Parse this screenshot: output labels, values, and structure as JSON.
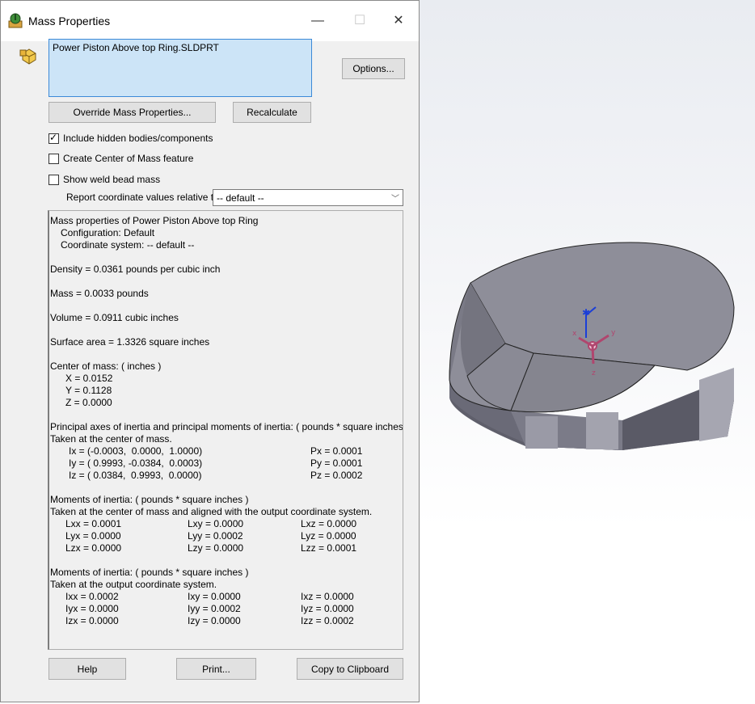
{
  "window": {
    "title": "Mass Properties",
    "minimize": "—",
    "maximize": "☐",
    "close": "✕"
  },
  "part_list": {
    "item": "Power Piston Above top Ring.SLDPRT"
  },
  "buttons": {
    "options": "Options...",
    "override": "Override Mass Properties...",
    "recalculate": "Recalculate",
    "help": "Help",
    "print": "Print...",
    "copy": "Copy to Clipboard"
  },
  "checkboxes": {
    "include_hidden": {
      "label": "Include hidden bodies/components",
      "checked": true
    },
    "create_com": {
      "label": "Create Center of Mass feature",
      "checked": false
    },
    "weld_bead": {
      "label": "Show weld bead mass",
      "checked": false
    }
  },
  "report": {
    "label": "Report coordinate values relative to:",
    "selected": "-- default --"
  },
  "results": {
    "header": "Mass properties of Power Piston Above top Ring",
    "configuration": "Configuration: Default",
    "coord_system": "Coordinate system: -- default --",
    "density": "Density = 0.0361 pounds per cubic inch",
    "mass": "Mass = 0.0033 pounds",
    "volume": "Volume = 0.0911 cubic inches",
    "surface_area": "Surface area = 1.3326 square inches",
    "com_title": "Center of mass: ( inches )",
    "com_x": "X = 0.0152",
    "com_y": "Y = 0.1128",
    "com_z": "Z = 0.0000",
    "principal_title": "Principal axes of inertia and principal moments of inertia: ( pounds * square inches )",
    "principal_sub": "Taken at the center of mass.",
    "ix": "Ix = (-0.0003,  0.0000,  1.0000)",
    "iy": "Iy = ( 0.9993, -0.0384,  0.0003)",
    "iz": "Iz = ( 0.0384,  0.9993,  0.0000)",
    "px": "Px = 0.0001",
    "py": "Py = 0.0001",
    "pz": "Pz = 0.0002",
    "moi1_title": "Moments of inertia: ( pounds * square inches )",
    "moi1_sub": "Taken at the center of mass and aligned with the output coordinate system.",
    "lxx": "Lxx = 0.0001",
    "lxy": "Lxy = 0.0000",
    "lxz": "Lxz = 0.0000",
    "lyx": "Lyx = 0.0000",
    "lyy": "Lyy = 0.0002",
    "lyz": "Lyz = 0.0000",
    "lzx": "Lzx = 0.0000",
    "lzy": "Lzy = 0.0000",
    "lzz": "Lzz = 0.0001",
    "moi2_title": "Moments of inertia: ( pounds * square inches )",
    "moi2_sub": "Taken at the output coordinate system.",
    "ixx": "Ixx = 0.0002",
    "ixy": "Ixy = 0.0000",
    "ixz": "Ixz = 0.0000",
    "iyx": "Iyx = 0.0000",
    "iyy": "Iyy = 0.0002",
    "iyz": "Iyz = 0.0000",
    "izx": "Izx = 0.0000",
    "izy": "Izy = 0.0000",
    "izz": "Izz = 0.0002"
  },
  "axes": {
    "x": "x",
    "y": "y",
    "z": "z"
  },
  "colors": {
    "selection": "#cce4f7",
    "selection_border": "#3c8ad8",
    "triad": "#b0466e",
    "part": "#8e8e99"
  }
}
